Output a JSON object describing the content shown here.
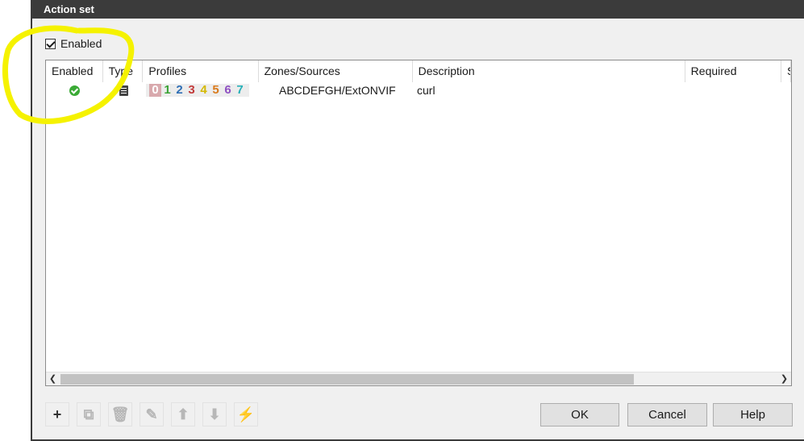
{
  "dialog": {
    "title": "Action set"
  },
  "enabled_checkbox": {
    "label": "Enabled",
    "checked": true
  },
  "table": {
    "columns": [
      "Enabled",
      "Type",
      "Profiles",
      "Zones/Sources",
      "Description",
      "Required",
      "S"
    ],
    "rows": [
      {
        "enabled": true,
        "type_icon": "document-icon",
        "profiles": [
          {
            "label": "0",
            "color": "#ffffff",
            "selected": true
          },
          {
            "label": "1",
            "color": "#3aa335"
          },
          {
            "label": "2",
            "color": "#2f6fb5"
          },
          {
            "label": "3",
            "color": "#c23a3a"
          },
          {
            "label": "4",
            "color": "#d4b800"
          },
          {
            "label": "5",
            "color": "#d97a1c"
          },
          {
            "label": "6",
            "color": "#8e4fc2"
          },
          {
            "label": "7",
            "color": "#27b0b8"
          }
        ],
        "zones": "ABCDEFGH/ExtONVIF",
        "description": "curl",
        "required": ""
      }
    ]
  },
  "toolbar": {
    "buttons": [
      {
        "name": "add-button",
        "icon": "plus-icon",
        "glyph": "+",
        "enabled": true
      },
      {
        "name": "duplicate-button",
        "icon": "duplicate-icon",
        "glyph": "⧉",
        "enabled": false
      },
      {
        "name": "delete-button",
        "icon": "trash-icon",
        "glyph": "🗑",
        "enabled": false
      },
      {
        "name": "edit-button",
        "icon": "edit-icon",
        "glyph": "✎",
        "enabled": false
      },
      {
        "name": "move-up-button",
        "icon": "arrow-up-icon",
        "glyph": "⬆",
        "enabled": false
      },
      {
        "name": "move-down-button",
        "icon": "arrow-down-icon",
        "glyph": "⬇",
        "enabled": false
      },
      {
        "name": "trigger-button",
        "icon": "lightning-icon",
        "glyph": "⚡",
        "enabled": true
      }
    ]
  },
  "buttons": {
    "ok": "OK",
    "cancel": "Cancel",
    "help": "Help"
  },
  "annotation": {
    "color": "#f5f200"
  }
}
